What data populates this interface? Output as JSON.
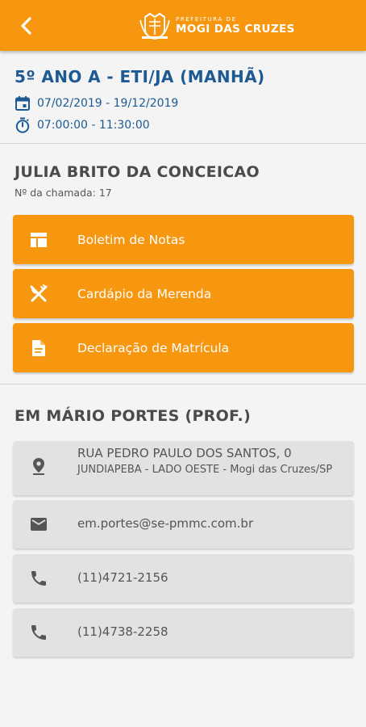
{
  "header": {
    "back_icon": "chevron-left-icon",
    "logo_small": "PREFEITURA DE",
    "logo_big": "MOGI DAS CRUZES",
    "color": "#f7960f"
  },
  "class_info": {
    "title": "5º ANO A - ETI/JA (MANHÃ)",
    "dates": "07/02/2019 - 19/12/2019",
    "times": "07:00:00 - 11:30:00",
    "date_icon": "calendar-icon",
    "time_icon": "timer-icon"
  },
  "student": {
    "name": "JULIA BRITO DA CONCEICAO",
    "call_number": "Nº da chamada: 17"
  },
  "actions": [
    {
      "label": "Boletim de Notas",
      "icon": "report-card-icon"
    },
    {
      "label": "Cardápio da Merenda",
      "icon": "cutlery-icon"
    },
    {
      "label": "Declaração de Matrícula",
      "icon": "document-icon"
    }
  ],
  "school": {
    "name": "EM MÁRIO PORTES (PROF.)",
    "address_line1": "RUA PEDRO PAULO DOS SANTOS, 0",
    "address_line2": "JUNDIAPEBA - LADO OESTE - Mogi das Cruzes/SP",
    "email": "em.portes@se-pmmc.com.br",
    "phone1": "(11)4721-2156",
    "phone2": "(11)4738-2258"
  }
}
